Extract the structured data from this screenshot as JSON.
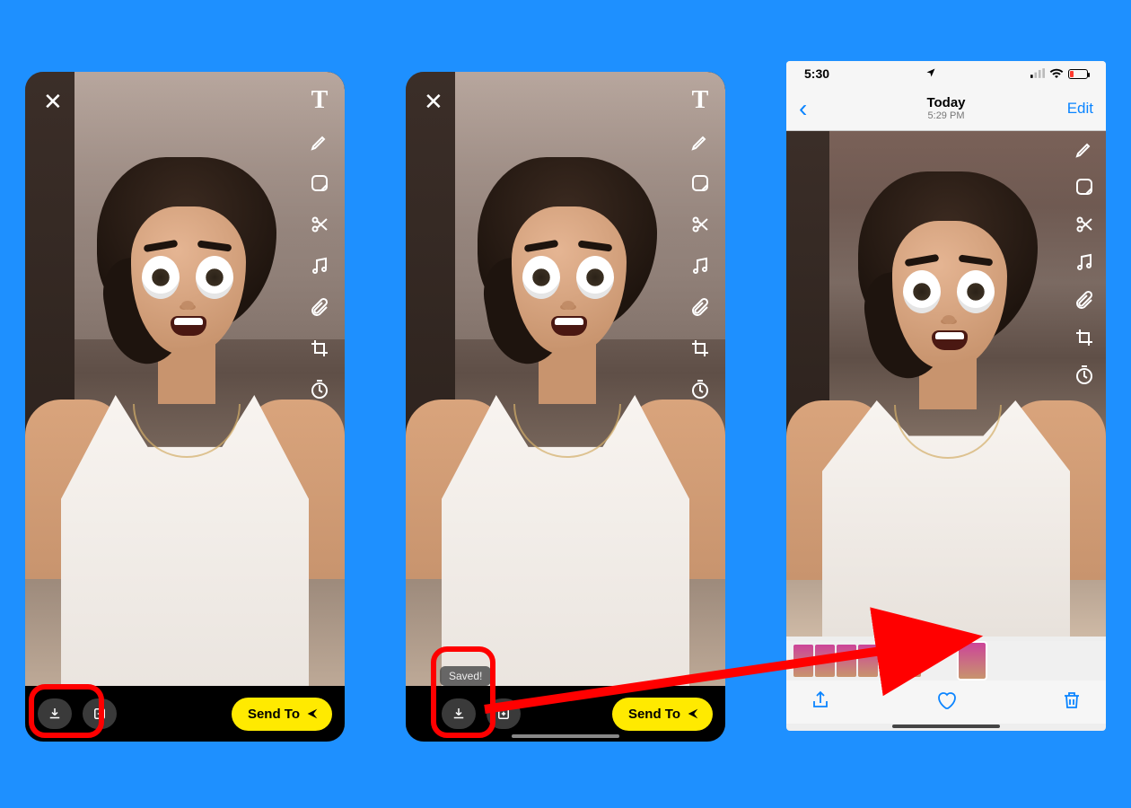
{
  "snap": {
    "close_icon": "close-icon",
    "tools": [
      "text",
      "pencil",
      "sticker",
      "scissors",
      "music",
      "attach",
      "crop",
      "timer"
    ],
    "send_label": "Send To",
    "saved_toast": "Saved!"
  },
  "photos": {
    "status_time": "5:30",
    "nav_title": "Today",
    "nav_subtitle": "5:29 PM",
    "back_label": "‹",
    "edit_label": "Edit"
  },
  "annotation": {
    "highlight_color": "#ff0000",
    "arrow_color": "#ff0000"
  }
}
